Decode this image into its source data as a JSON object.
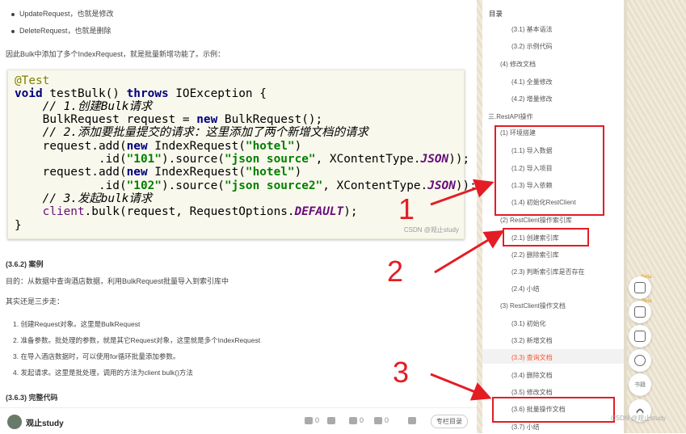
{
  "article": {
    "bullets": [
      "UpdateRequest，也就是修改",
      "DeleteRequest，也就是删除"
    ],
    "intro": "因此Bulk中添加了多个IndexRequest，就是批量新增功能了。示例：",
    "code_watermark": "CSDN @观止study",
    "section_case": "(3.6.2) 案例",
    "purpose": "目的：从数据中查询酒店数据，利用BulkRequest批量导入到索引库中",
    "steps_intro": "其实还是三步走：",
    "steps": [
      "1. 创建Request对象。这里是BulkRequest",
      "2. 准备参数。批处理的参数，就是其它Request对象，这里就是多个IndexRequest",
      "3. 在导入酒店数据时，可以使用for循环批量添加参数。",
      "4. 发起请求。这里是批处理，调用的方法为client bulk()方法"
    ],
    "section_full": "(3.6.3) 完整代码"
  },
  "code": {
    "line1": "@Test",
    "line2_kw1": "void",
    "line2_mid": " testBulk() ",
    "line2_kw2": "throws",
    "line2_end": " IOException {",
    "line3": "    // 1.创建Bulk请求",
    "line4_a": "    BulkRequest request = ",
    "line4_kw": "new",
    "line4_b": " BulkRequest();",
    "line5": "    // 2.添加要批量提交的请求：这里添加了两个新增文档的请求",
    "line6_a": "    request.add(",
    "line6_kw": "new",
    "line6_b": " IndexRequest(",
    "line6_str": "\"hotel\"",
    "line6_c": ")",
    "line7_a": "            .id(",
    "line7_str1": "\"101\"",
    "line7_b": ").source(",
    "line7_str2": "\"json source\"",
    "line7_c": ", XContentType.",
    "line7_it": "JSON",
    "line7_d": "));",
    "line8_a": "    request.add(",
    "line8_kw": "new",
    "line8_b": " IndexRequest(",
    "line8_str": "\"hotel\"",
    "line8_c": ")",
    "line9_a": "            .id(",
    "line9_str1": "\"102\"",
    "line9_b": ").source(",
    "line9_str2": "\"json source2\"",
    "line9_c": ", XContentType.",
    "line9_it": "JSON",
    "line9_d": "));",
    "line10": "    // 3.发起bulk请求",
    "line11_a": "    ",
    "line11_fld": "client",
    "line11_b": ".bulk(request, RequestOptions.",
    "line11_it": "DEFAULT",
    "line11_c": ");",
    "line12": "}"
  },
  "footer": {
    "author": "观止study",
    "like_count": "0",
    "dislike_count": "0",
    "collect_count": "0",
    "comment_count": "0",
    "toc_button": "专栏目录"
  },
  "toc": {
    "title": "目录",
    "items": [
      "(3.1) 基本语法",
      "(3.2) 示例代码",
      "(4) 修改文档",
      "(4.1) 全量修改",
      "(4.2) 增量修改",
      "三.RestAPI操作",
      "(1) 环境搭建",
      "(1.1) 导入数据",
      "(1.2) 导入项目",
      "(1.3) 导入依赖",
      "(1.4) 初始化RestClient",
      "(2) RestClient操作索引库",
      "(2.1) 创建索引库",
      "(2.2) 删除索引库",
      "(2.3) 判断索引库是否存在",
      "(2.4) 小结",
      "(3) RestClient操作文档",
      "(3.1) 初始化",
      "(3.2) 新增文档",
      "(3.3) 查询文档",
      "(3.4) 删除文档",
      "(3.5) 修改文档",
      "(3.6) 批量操作文档",
      "(3.7) 小结"
    ],
    "active_index": 19
  },
  "annotations": {
    "num1": "1",
    "num2": "2",
    "num3": "3",
    "color": "#e41c24"
  },
  "side_tools": {
    "beta1": "Beta",
    "beta2": "Beta",
    "read_label": "书籍"
  },
  "watermark": "CSDN @观止study"
}
